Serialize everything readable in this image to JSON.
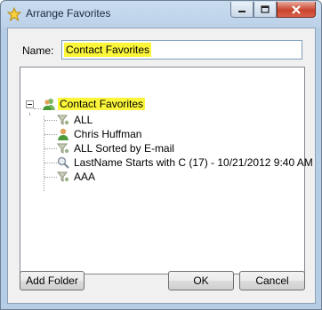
{
  "window": {
    "title": "Arrange Favorites",
    "icon": "star-icon"
  },
  "caption": {
    "minimize": "minimize-icon",
    "maximize": "maximize-icon",
    "close": "close-icon"
  },
  "form": {
    "name_label": "Name:",
    "name_value": "Contact Favorites"
  },
  "tree": {
    "root": {
      "label": "Contact Favorites",
      "icon": "contact-group-icon",
      "expanded": true
    },
    "children": [
      {
        "label": "ALL",
        "icon": "filter-icon"
      },
      {
        "label": "Chris Huffman",
        "icon": "contact-icon"
      },
      {
        "label": "ALL Sorted by E-mail",
        "icon": "filter-icon"
      },
      {
        "label": "LastName Starts with C (17) - 10/21/2012 9:40 AM",
        "icon": "search-icon"
      },
      {
        "label": "AAA",
        "icon": "filter-icon"
      }
    ]
  },
  "buttons": {
    "add_folder": "Add Folder",
    "ok": "OK",
    "cancel": "Cancel"
  },
  "colors": {
    "highlight": "#fbf63a",
    "title_bar": "#bcd2ea",
    "close_button": "#c9442c"
  }
}
